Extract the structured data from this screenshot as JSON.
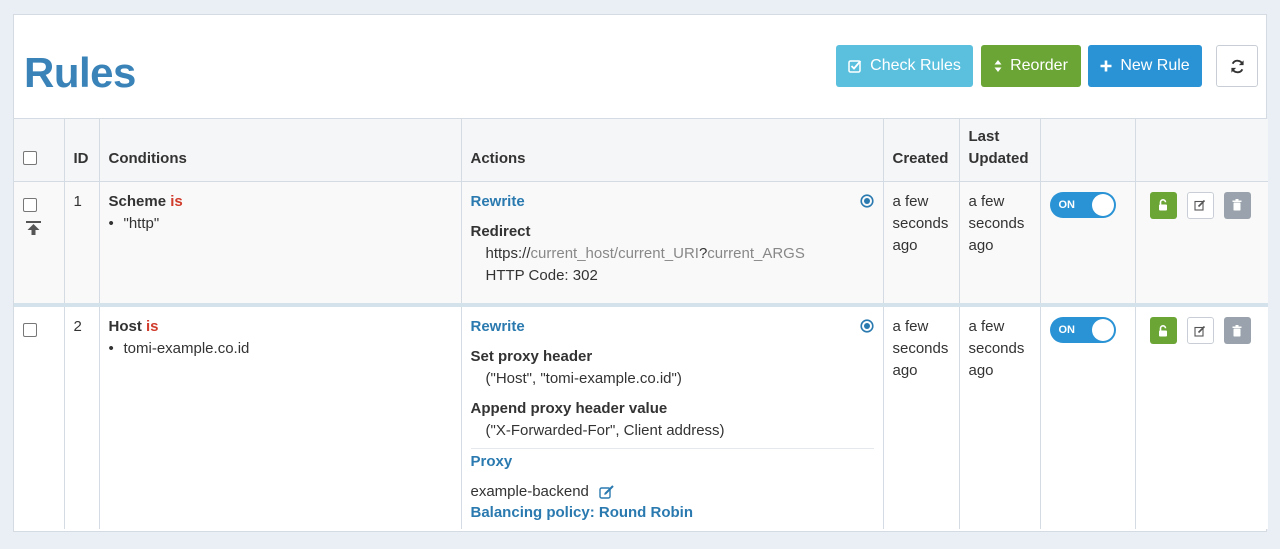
{
  "page": {
    "title": "Rules"
  },
  "toolbar": {
    "check_label": "Check Rules",
    "reorder_label": "Reorder",
    "new_label": "New Rule"
  },
  "columns": {
    "id": "ID",
    "conditions": "Conditions",
    "actions": "Actions",
    "created": "Created",
    "updated_line1": "Last",
    "updated_line2": "Updated"
  },
  "rows": [
    {
      "id": "1",
      "condition": {
        "field": "Scheme",
        "op": "is",
        "values": [
          "\"http\""
        ]
      },
      "actions": {
        "type": "Rewrite",
        "label": "Redirect",
        "url_prefix": "https://",
        "url_host": "current_host",
        "url_sep1": "/",
        "url_uri": "current_URI",
        "url_sep2": "?",
        "url_args": "current_ARGS",
        "code": "HTTP Code: 302"
      },
      "created": "a few seconds ago",
      "updated": "a few seconds ago",
      "toggle": "ON"
    },
    {
      "id": "2",
      "condition": {
        "field": "Host",
        "op": "is",
        "values": [
          "tomi-example.co.id"
        ]
      },
      "actions": {
        "type": "Rewrite",
        "label1": "Set proxy header",
        "detail1": "(\"Host\", \"tomi-example.co.id\")",
        "label2": "Append proxy header value",
        "detail2": "(\"X-Forwarded-For\", Client address)",
        "proxy_label": "Proxy",
        "backend": "example-backend",
        "policy": "Balancing policy: Round Robin"
      },
      "created": "a few seconds ago",
      "updated": "a few seconds ago",
      "toggle": "ON"
    }
  ],
  "colors": {
    "title": "#3a83b8",
    "check_button": "#5bc0de",
    "reorder_button": "#6aa535",
    "new_button": "#2a93d5",
    "keyword": "#d03b2b",
    "link": "#2a7ab0"
  },
  "icons": {
    "check": "check-square-icon",
    "reorder": "sort-icon",
    "new": "plus-icon",
    "refresh": "refresh-icon",
    "pin": "pin-top-icon",
    "selected": "radio-selected-icon",
    "edit_external": "edit-external-icon",
    "lock": "unlock-icon",
    "edit": "edit-icon",
    "delete": "trash-icon"
  }
}
